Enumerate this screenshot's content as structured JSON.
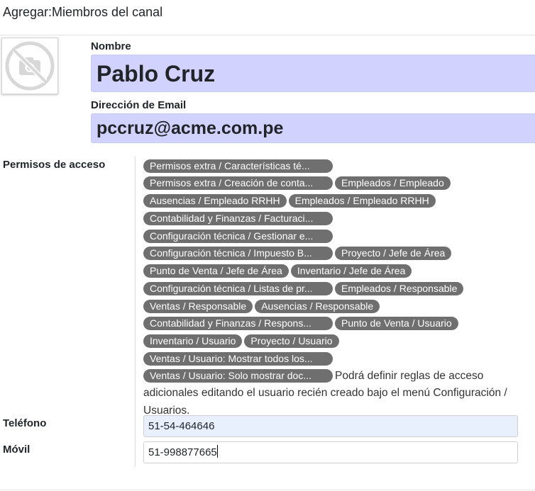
{
  "header": {
    "title": "Agregar:Miembros del canal"
  },
  "avatar": {
    "icon": "camera-slash-icon"
  },
  "form": {
    "name_label": "Nombre",
    "name_value": "Pablo Cruz",
    "email_label": "Dirección de Email",
    "email_value": "pccruz@acme.com.pe",
    "access_label": "Permisos de acceso",
    "tags": [
      "Permisos extra / Características té...",
      "Permisos extra / Creación de conta...",
      "Empleados / Empleado",
      "Ausencias / Empleado RRHH",
      "Empleados / Empleado RRHH",
      "Contabilidad y Finanzas / Facturaci...",
      "Configuración técnica / Gestionar e...",
      "Configuración técnica / Impuesto B...",
      "Proyecto / Jefe de Área",
      "Punto de Venta / Jefe de Área",
      "Inventario / Jefe de Área",
      "Configuración técnica / Listas de pr...",
      "Empleados / Responsable",
      "Ventas / Responsable",
      "Ausencias / Responsable",
      "Contabilidad y Finanzas / Respons...",
      "Punto de Venta / Usuario",
      "Inventario / Usuario",
      "Proyecto / Usuario",
      "Ventas / Usuario: Mostrar todos los...",
      "Ventas / Usuario: Solo mostrar doc..."
    ],
    "access_note": "Podrá definir reglas de acceso adicionales editando el usuario recién creado bajo el menú Configuración / Usuarios.",
    "phone_label": "Teléfono",
    "phone_value": "51-54-464646",
    "mobile_label": "Móvil",
    "mobile_value": "51-998877665"
  },
  "colors": {
    "highlight_field": "#d2d2ff",
    "tag_bg": "#6f6f6f",
    "autofill_bg": "#e8f0fe"
  }
}
